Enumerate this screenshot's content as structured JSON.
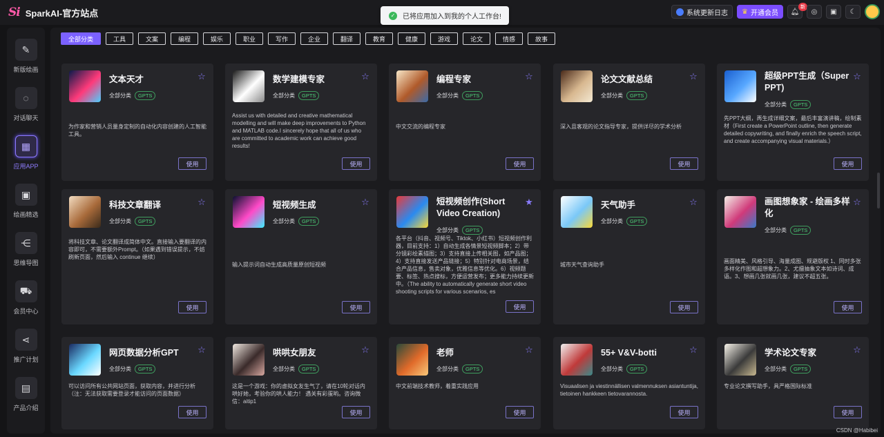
{
  "app": {
    "logo_text": "Si",
    "title": "SparkAI-官方站点",
    "toast": "已将应用加入到我的个人工作台!",
    "update_log": "系统更新日志",
    "vip": "开通会员",
    "new_badge": "新",
    "watermark": "CSDN @Habibei"
  },
  "sidebar": [
    {
      "label": "新版绘画",
      "icon": "paint-brush-icon",
      "glyph": "✎"
    },
    {
      "label": "对话聊天",
      "icon": "chat-bubble-icon",
      "glyph": "◌"
    },
    {
      "label": "应用APP",
      "icon": "apps-grid-icon",
      "glyph": "▦"
    },
    {
      "label": "绘画精选",
      "icon": "image-icon",
      "glyph": "▣"
    },
    {
      "label": "思维导图",
      "icon": "mindmap-icon",
      "glyph": "⋲"
    },
    {
      "label": "会员中心",
      "icon": "cart-icon",
      "glyph": "⛟"
    },
    {
      "label": "推广计划",
      "icon": "share-icon",
      "glyph": "⋖"
    },
    {
      "label": "产品介绍",
      "icon": "product-icon",
      "glyph": "▤"
    }
  ],
  "categories": [
    "全部分类",
    "工具",
    "文案",
    "编程",
    "娱乐",
    "职业",
    "写作",
    "企业",
    "翻译",
    "教育",
    "健康",
    "游戏",
    "论文",
    "情感",
    "故事"
  ],
  "card_tag_category": "全部分类",
  "card_tag_type": "GPTS",
  "use_label": "使用",
  "cards": [
    {
      "title": "文本天才",
      "desc": "为作家和营销人员量身定制的自动化内容创建的人工智能工具。",
      "starred": false
    },
    {
      "title": "数学建模专家",
      "desc": "Assist us with detailed and creative mathematical modelling and will make deep improvements to Python and MATLAB code.I sincerely hope that all of us who are committed to academic work can achieve good results!",
      "starred": false
    },
    {
      "title": "编程专家",
      "desc": "中文交流的编程专家",
      "starred": false
    },
    {
      "title": "论文文献总结",
      "desc": "深入且客观的论文指导专家，提供详尽的学术分析",
      "starred": false
    },
    {
      "title": "超级PPT生成（Super PPT)",
      "desc": "先PPT大纲，再生成详细文案，最后丰富演讲稿，绘制素材（First create a PowerPoint outline, then generate detailed copywriting, and finally enrich the speech script, and create accompanying visual materials.）",
      "starred": false
    },
    {
      "title": "科技文章翻译",
      "desc": "将科技文章、论文翻译成简体中文。直接输入要翻译的内容即可，不需要额外Prompt。（如果遇到错误提示，不妨刷新页面，然后输入 continue 继续）",
      "starred": false
    },
    {
      "title": "短视频生成",
      "desc": "输入提示词自动生成高质量原创短视频",
      "starred": false
    },
    {
      "title": "短视频创作(Short Video Creation)",
      "desc": "各平台（抖音、视频号、Tiktok、小红书）短视频创作利器，目前支持：1）自动生成各情景短视频脚本；2）带分镜彩绘素描图；3）支持直接上传相关图，如产品图；4）支持直接发送产品链接；5）特别针对电商场景，结合产品信息，售卖对象，优雅信息等优化。6）视频题要、标签、热点搜标，方便运营发布；更多能力持续更新中。（The ability to automatically generate short video shooting scripts for various scenarios, es",
      "starred": true
    },
    {
      "title": "天气助手",
      "desc": "城市天气查询助手",
      "starred": false
    },
    {
      "title": "画图想象家 - 绘画多样化",
      "desc": "画面精美、风格引导、海量成图、规避版权 1、同时多张多样化作图和超想象力。2、尤擅抽象文本如诗词、成语。3、想画几张就画几张，建议不超五张。",
      "starred": false
    },
    {
      "title": "网页数据分析GPT",
      "desc": "可以访问所有公共网站页面，获取内容，并进行分析（注：无法获取需要登录才能访问的页面数据）",
      "starred": false
    },
    {
      "title": "哄哄女朋友",
      "desc": "这是一个游戏：你的虚拟女友生气了，请在10轮对话内哄好她，考验你的哄人能力！ 遇关有彩蛋哟。咨询微信：aitip1",
      "starred": false
    },
    {
      "title": "老师",
      "desc": "中文前端技术教师，着重实践应用",
      "starred": false
    },
    {
      "title": "55+ V&V-botti",
      "desc": "Visuaalisen ja viestinnällisen valmennuksen asiantuntija, tietoinen hankkeen tietovarannosta.",
      "starred": false
    },
    {
      "title": "学术论文专家",
      "desc": "专业论文撰写助手，具严格国际标准",
      "starred": false
    }
  ]
}
